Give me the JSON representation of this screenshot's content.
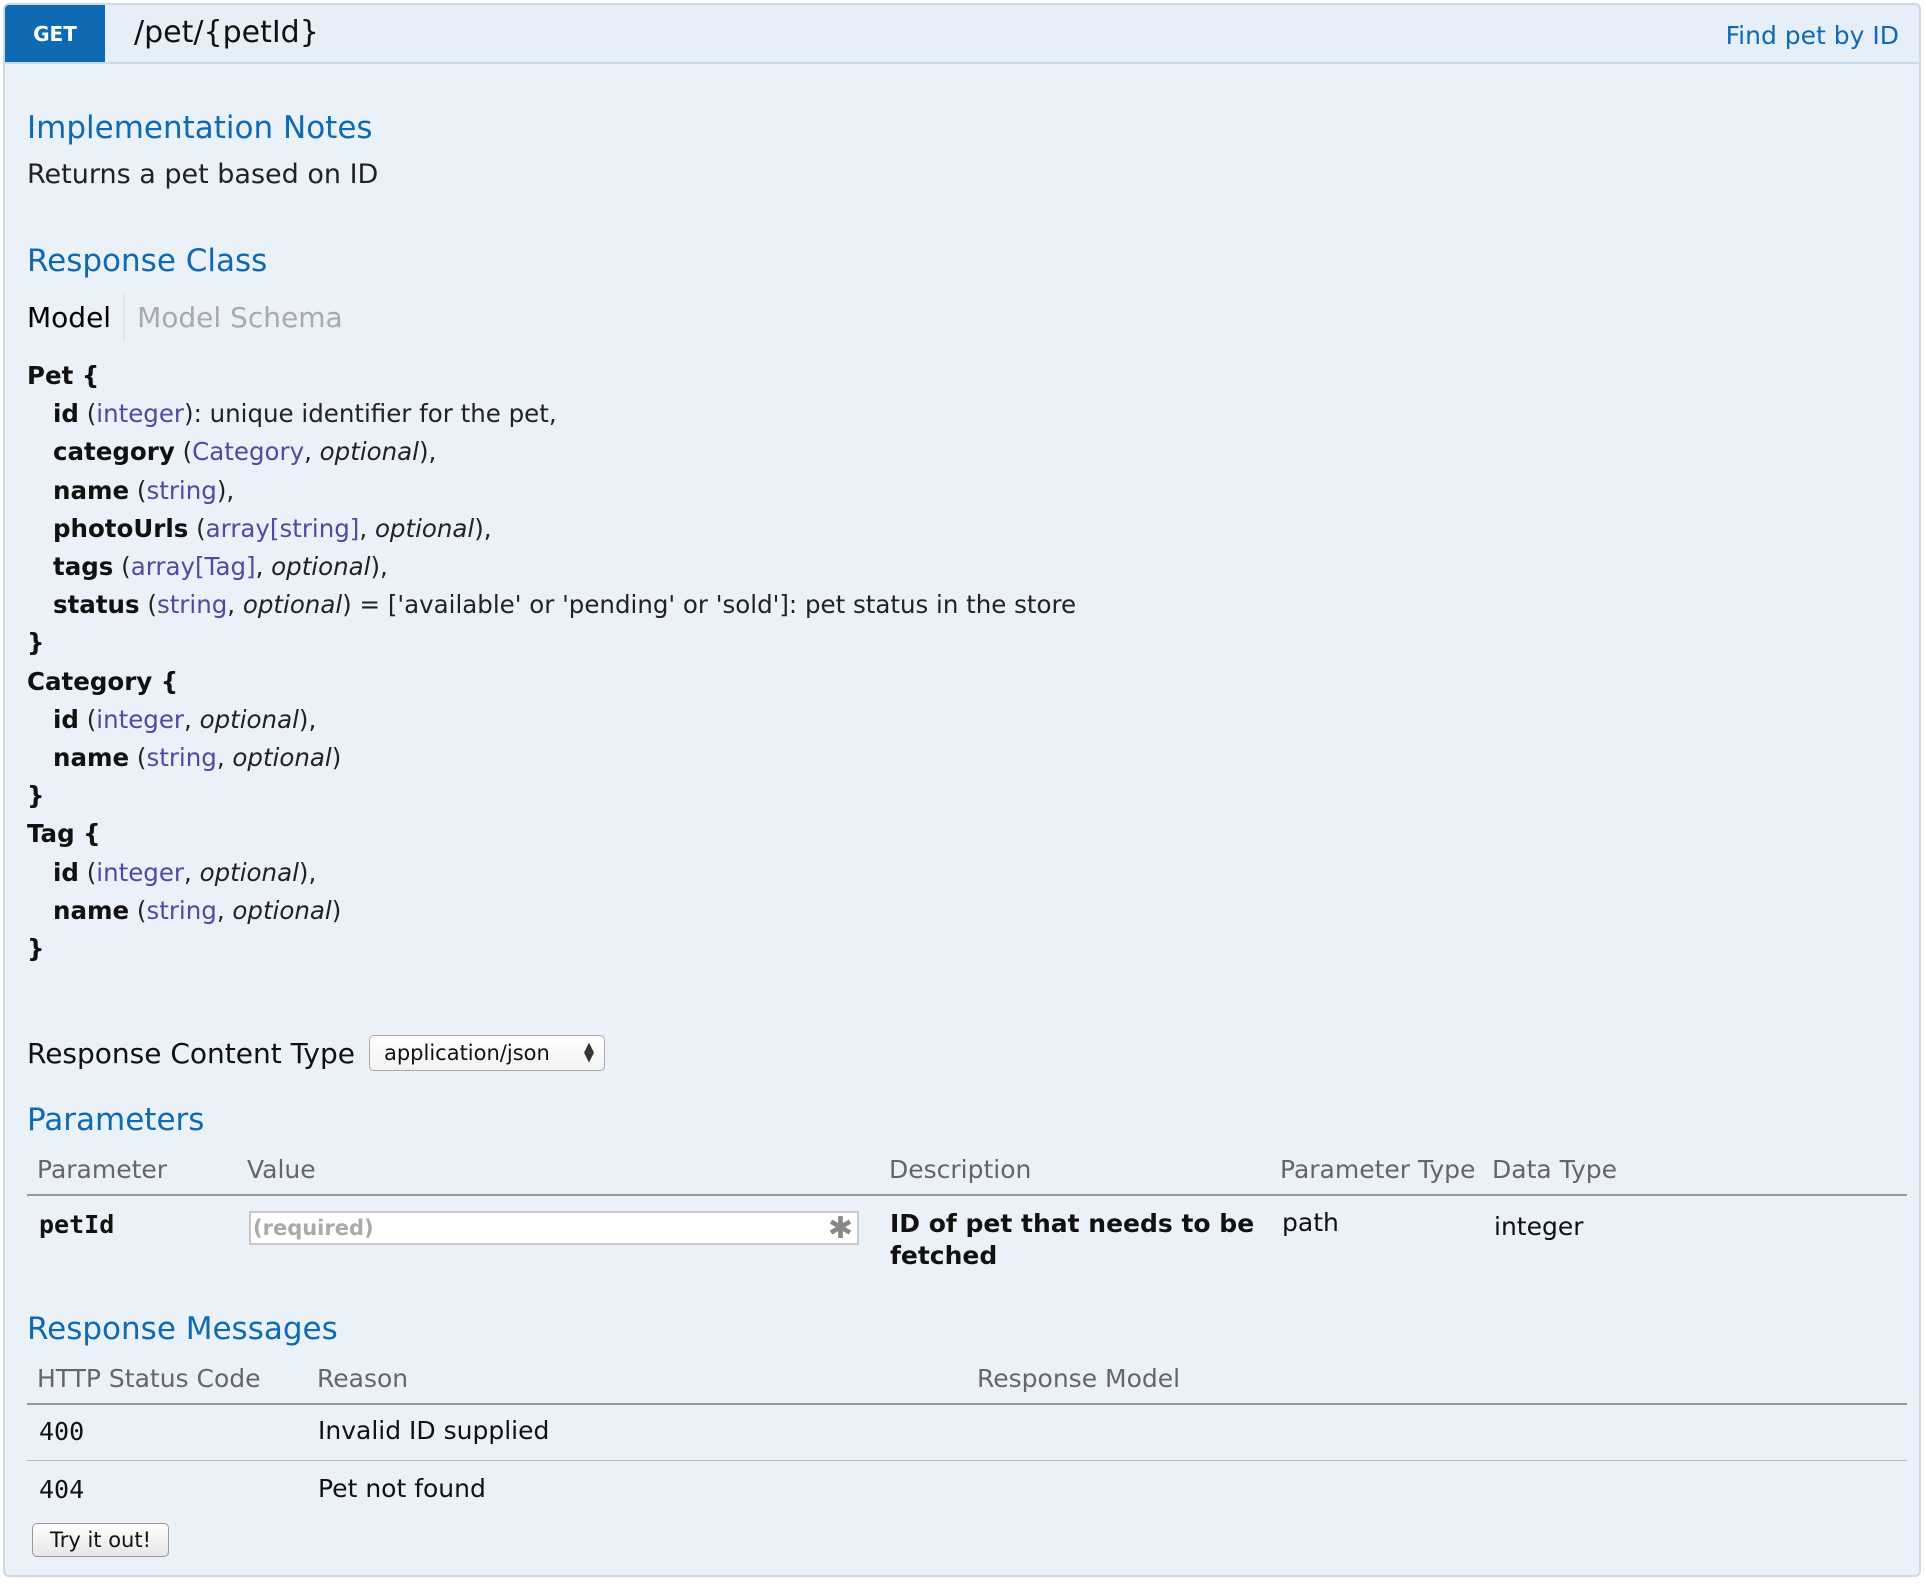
{
  "operation": {
    "method": "GET",
    "path": "/pet/{petId}",
    "summary": "Find pet by ID"
  },
  "implementation_notes": {
    "heading": "Implementation Notes",
    "text": "Returns a pet based on ID"
  },
  "response_class": {
    "heading": "Response Class",
    "tabs": [
      "Model",
      "Model Schema"
    ],
    "selected_tab": "Model",
    "pet": {
      "name": "Pet",
      "fields": [
        {
          "name": "id",
          "type": "integer",
          "rest": "): unique identifier for the pet,"
        },
        {
          "name": "category",
          "type": "Category",
          "optional": "optional",
          "rest": "),"
        },
        {
          "name": "name",
          "type": "string",
          "rest": "),"
        },
        {
          "name": "photoUrls",
          "type": "array[string]",
          "optional": "optional",
          "rest": "),"
        },
        {
          "name": "tags",
          "type": "array[Tag]",
          "optional": "optional",
          "rest": "),"
        },
        {
          "name": "status",
          "type": "string",
          "optional": "optional",
          "rest": ") = ['available' or 'pending' or 'sold']: pet status in the store"
        }
      ]
    },
    "category": {
      "name": "Category",
      "fields": [
        {
          "name": "id",
          "type": "integer",
          "optional": "optional",
          "rest": "),"
        },
        {
          "name": "name",
          "type": "string",
          "optional": "optional",
          "rest": ")"
        }
      ]
    },
    "tag": {
      "name": "Tag",
      "fields": [
        {
          "name": "id",
          "type": "integer",
          "optional": "optional",
          "rest": "),"
        },
        {
          "name": "name",
          "type": "string",
          "optional": "optional",
          "rest": ")"
        }
      ]
    }
  },
  "response_content_type": {
    "label": "Response Content Type",
    "selected": "application/json"
  },
  "parameters": {
    "heading": "Parameters",
    "columns": [
      "Parameter",
      "Value",
      "Description",
      "Parameter Type",
      "Data Type"
    ],
    "rows": [
      {
        "parameter": "petId",
        "value": "",
        "placeholder": "(required)",
        "description_line1": "ID of pet that needs to be",
        "description_line2": "fetched",
        "parameter_type": "path",
        "data_type": "integer"
      }
    ]
  },
  "response_messages": {
    "heading": "Response Messages",
    "columns": [
      "HTTP Status Code",
      "Reason",
      "Response Model"
    ],
    "rows": [
      {
        "code": "400",
        "reason": "Invalid ID supplied",
        "model": ""
      },
      {
        "code": "404",
        "reason": "Pet not found",
        "model": ""
      }
    ]
  },
  "try_button": "Try it out!",
  "colors": {
    "accent": "#0f6ab4",
    "panel_bg": "#eaf1f9",
    "panel_border": "#c9daea",
    "type_color": "#4c4ca0"
  }
}
